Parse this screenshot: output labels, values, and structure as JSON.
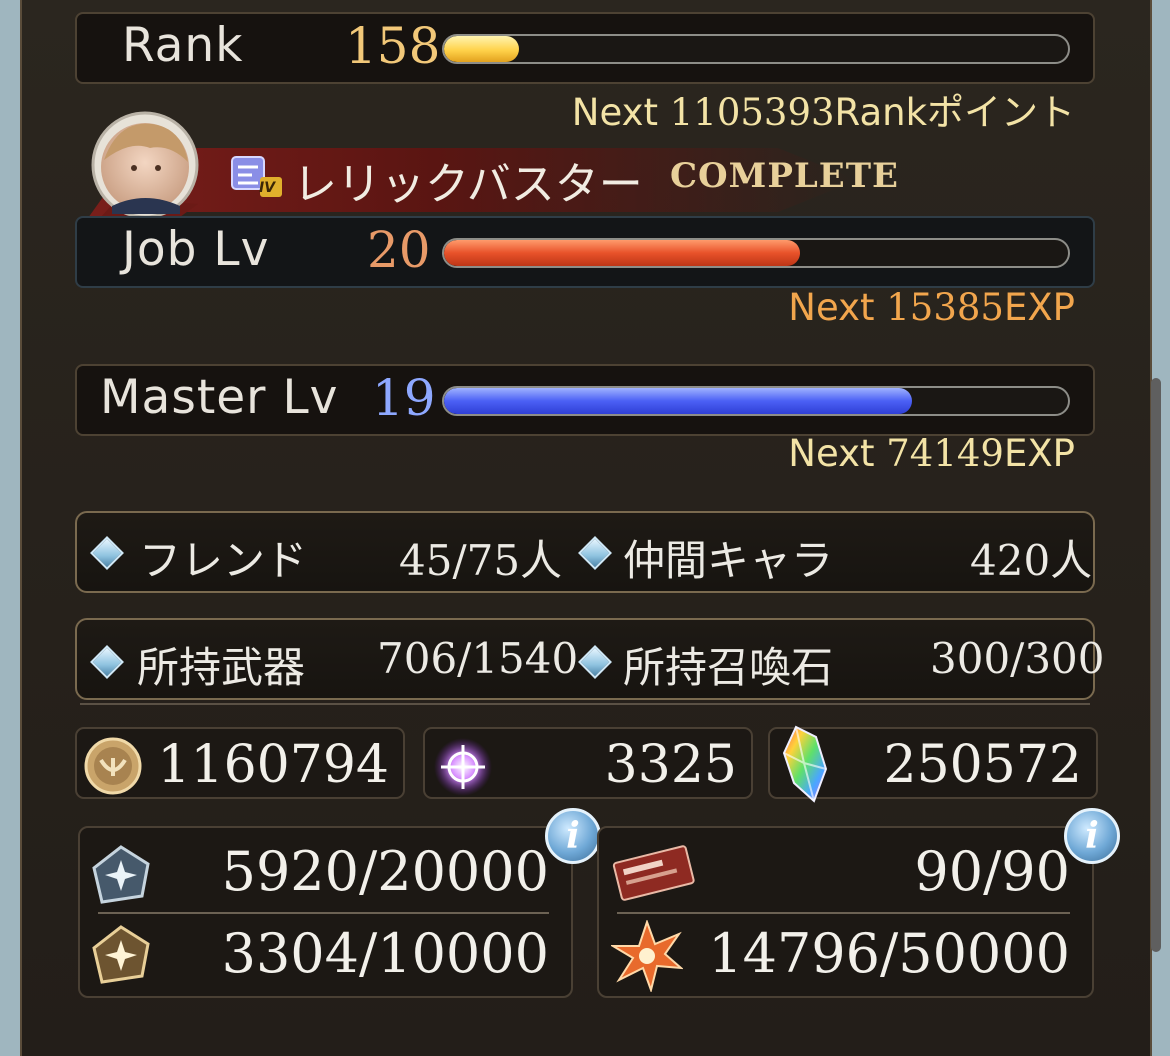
{
  "rank": {
    "label": "Rank",
    "value": "158",
    "progress": 0.12,
    "next_prefix": "Next ",
    "next_value": "1105393",
    "next_suffix": "Rankポイント"
  },
  "job_banner": {
    "tier_badge": "IV",
    "name": "レリックバスター",
    "status": "COMPLETE"
  },
  "job_level": {
    "label": "Job Lv",
    "value": "20",
    "progress": 0.57,
    "next_prefix": "Next ",
    "next_value": "15385",
    "next_suffix": "EXP"
  },
  "master_level": {
    "label": "Master Lv",
    "value": "19",
    "progress": 0.75,
    "next_prefix": "Next ",
    "next_value": "74149",
    "next_suffix": "EXP"
  },
  "social": {
    "friends_label": "フレンド",
    "friends_value": "45/75",
    "friends_unit": "人",
    "characters_label": "仲間キャラ",
    "characters_value": "420",
    "characters_unit": "人"
  },
  "inventory": {
    "weapons_label": "所持武器",
    "weapons_value": "706/1540",
    "summons_label": "所持召喚石",
    "summons_value": "300/300"
  },
  "currencies": {
    "rupie": "1160794",
    "crystal_point": "3325",
    "crystals": "250572"
  },
  "stamina": {
    "ap": "5920/20000",
    "bp": "3304/10000",
    "tickets": "90/90",
    "fragments": "14796/50000",
    "info_label": "i"
  },
  "colors": {
    "rank_num": "#f2c879",
    "job_num": "#e89a68",
    "master_num": "#8ea8ff",
    "next_gold": "#f3e3a6",
    "next_orange": "#f2a64d"
  }
}
